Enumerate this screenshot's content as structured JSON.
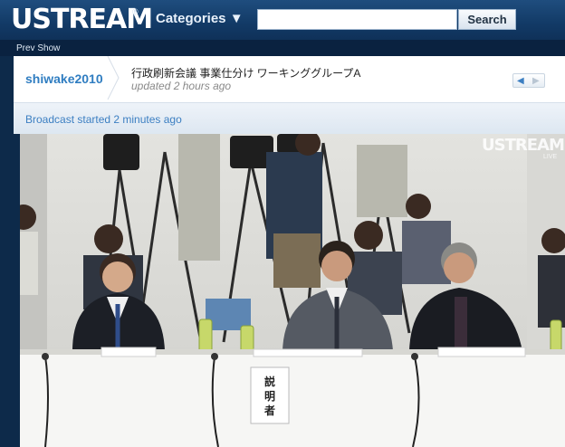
{
  "header": {
    "logo": "USTREAM",
    "logo_mark": "®",
    "categories_label": "Categories ▼",
    "search": {
      "value": "",
      "button": "Search"
    }
  },
  "prev_show": "Prev Show",
  "show": {
    "channel": "shiwake2010",
    "title": "行政刷新会議  事業仕分け  ワーキンググループA",
    "updated": "updated 2 hours ago",
    "nav_prev": "◀",
    "nav_next": "▶"
  },
  "status": "Broadcast started 2 minutes ago",
  "video": {
    "watermark": "USTREAM",
    "watermark_sub": "LIVE",
    "placard": [
      "説",
      "明",
      "者"
    ]
  },
  "colors": {
    "header": "#1f4d7e",
    "link": "#2f7dc1",
    "background": "#0d2a4a"
  }
}
